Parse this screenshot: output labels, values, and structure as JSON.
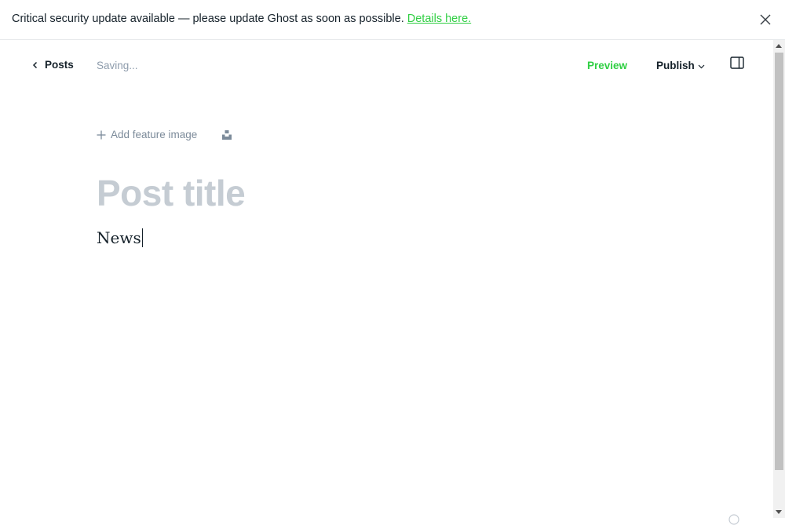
{
  "banner": {
    "message": "Critical security update available — please update Ghost as soon as possible.",
    "link_label": "Details here.",
    "close_icon": "close-icon"
  },
  "header": {
    "back_label": "Posts",
    "status": "Saving...",
    "preview_label": "Preview",
    "publish_label": "Publish",
    "sidebar_icon": "sidebar-toggle-icon"
  },
  "editor": {
    "feature_image_label": "Add feature image",
    "title_placeholder": "Post title",
    "body_text": "News"
  },
  "colors": {
    "accent": "#30cf43",
    "text": "#15212a",
    "muted": "#8e9cac",
    "title_placeholder": "#c5ccd3"
  }
}
